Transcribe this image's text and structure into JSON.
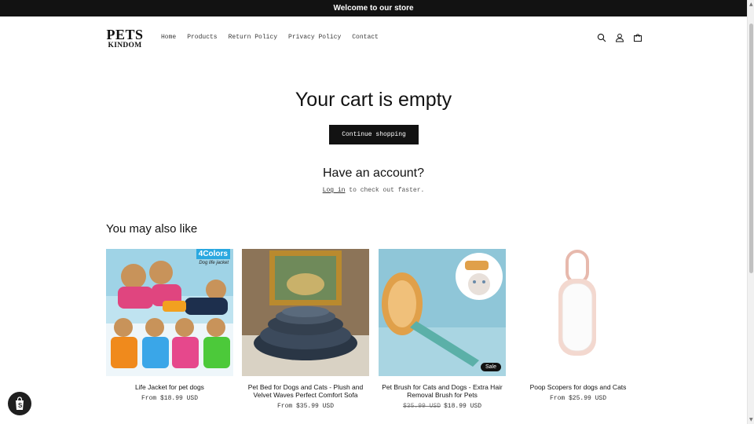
{
  "announcement": "Welcome to our store",
  "logo": {
    "line1": "PETS",
    "line2": "KINDOM"
  },
  "nav": [
    "Home",
    "Products",
    "Return Policy",
    "Privacy Policy",
    "Contact"
  ],
  "header_icons": [
    "search-icon",
    "account-icon",
    "cart-icon"
  ],
  "cart": {
    "title": "Your cart is empty",
    "continue_label": "Continue shopping"
  },
  "account": {
    "title": "Have an account?",
    "login_link": "Log in",
    "login_rest": " to check out faster."
  },
  "recommendations": {
    "title": "You may also like",
    "products": [
      {
        "name": "Life Jacket for pet dogs",
        "price_prefix": "From ",
        "price": "$18.99 USD",
        "badge_colors": "4Colors",
        "badge_sub": "Dog life jacket"
      },
      {
        "name": "Pet Bed for Dogs and Cats - Plush and Velvet Waves Perfect Comfort Sofa",
        "price_prefix": "From ",
        "price": "$35.99 USD"
      },
      {
        "name": "Pet Brush for Cats and Dogs - Extra Hair Removal Brush for Pets",
        "old_price": "$35.99 USD",
        "price": "$18.99 USD",
        "sale_label": "Sale"
      },
      {
        "name": "Poop Scopers for dogs and Cats",
        "price_prefix": "From ",
        "price": "$25.99 USD"
      }
    ]
  },
  "colors": {
    "dark": "#121212",
    "accent_badge": "#2aa8e0",
    "background": "#ffffff"
  }
}
